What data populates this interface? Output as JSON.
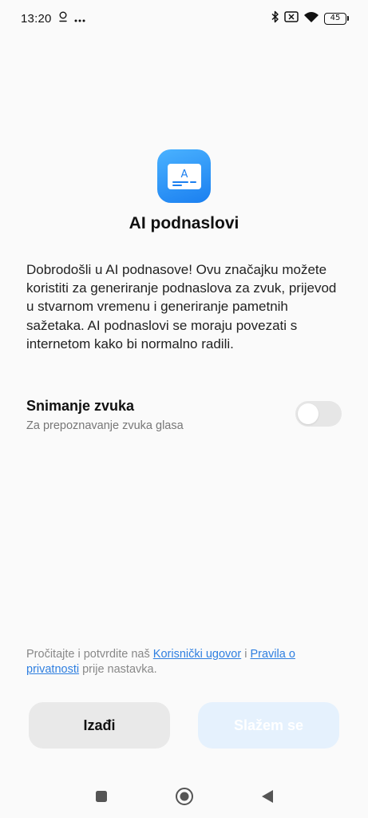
{
  "status_bar": {
    "time": "13:20",
    "battery": "45"
  },
  "app": {
    "icon_letter": "A",
    "title": "AI podnaslovi"
  },
  "description": "Dobrodošli u AI podnasove! Ovu značajku možete koristiti za generiranje podnaslova za zvuk, prijevod u stvarnom vremenu i generiranje pametnih sažetaka. AI podnaslovi se moraju povezati s internetom kako bi normalno radili.",
  "setting": {
    "title": "Snimanje zvuka",
    "subtitle": "Za prepoznavanje zvuka glasa",
    "enabled": false
  },
  "legal": {
    "prefix": "Pročitajte i potvrdite naš ",
    "link1": "Korisnički ugovor",
    "middle": " i ",
    "link2": "Pravila o privatnosti",
    "suffix": " prije nastavka."
  },
  "buttons": {
    "exit": "Izađi",
    "agree": "Slažem se"
  },
  "colors": {
    "accent": "#2f7fe0",
    "icon_gradient_start": "#4ab2ff",
    "icon_gradient_end": "#1a7ff0",
    "agree_button_bg": "#e5f1fd"
  }
}
